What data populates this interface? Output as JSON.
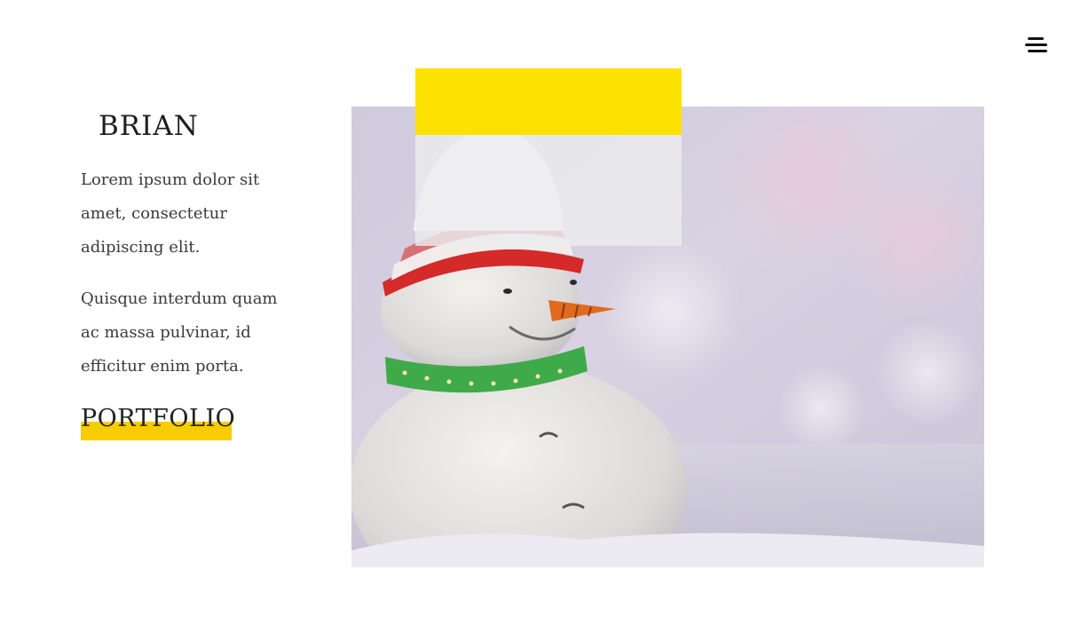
{
  "header": {
    "menu_icon": "hamburger-menu-icon"
  },
  "intro": {
    "name": "BRIAN",
    "paragraphs": [
      "Lorem ipsum dolor sit amet, consectetur adipiscing elit.",
      "Quisque interdum quam ac massa pulvinar, id efficitur enim porta."
    ],
    "portfolio_link": "PORTFOLIO"
  },
  "colors": {
    "accent_yellow": "#fde100",
    "highlight_yellow": "#f7cc00",
    "text_dark": "#1e1e1e"
  }
}
